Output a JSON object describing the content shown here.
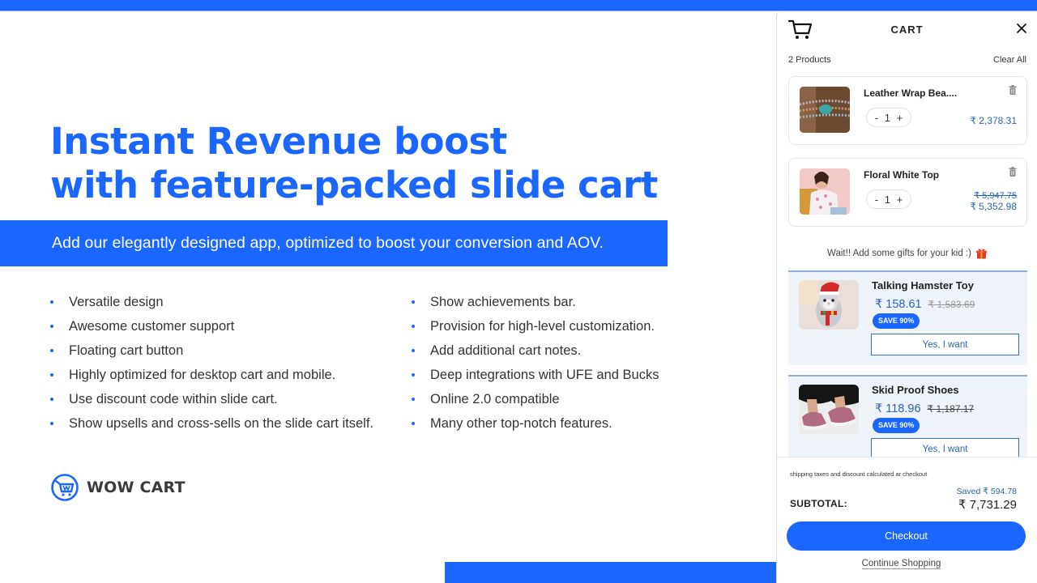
{
  "hero": {
    "headline_line1": "Instant Revenue boost",
    "headline_line2": "with feature-packed slide cart",
    "subtitle": "Add our elegantly designed app, optimized to boost your conversion and AOV."
  },
  "features": {
    "column1": [
      "Versatile design",
      "Awesome customer support",
      "Floating cart button",
      "Highly optimized for desktop cart and mobile.",
      "Use discount code within slide cart.",
      "Show upsells and cross-sells on the slide cart itself."
    ],
    "column2": [
      "Show achievements bar.",
      "Provision for high-level customization.",
      "Add additional cart notes.",
      "Deep integrations with UFE and Bucks",
      "Online 2.0 compatible",
      "Many other top-notch features."
    ]
  },
  "brand": {
    "name": "WOW CART",
    "icon": "cart-circle-logo",
    "color": "#1a66ff"
  },
  "cart": {
    "title": "CART",
    "product_count": "2 Products",
    "clear_all": "Clear All",
    "items": [
      {
        "name": "Leather Wrap Bea....",
        "quantity": "1",
        "price": "₹ 2,378.31",
        "old_price": null,
        "image": "bracelet-photo"
      },
      {
        "name": "Floral White Top",
        "quantity": "1",
        "price": "₹ 5,352.98",
        "old_price": "₹ 5,947.75",
        "image": "floral-top-photo"
      }
    ],
    "qty_minus": "-",
    "qty_plus": "+",
    "gift_message": "Wait!! Add some gifts for your kid :)",
    "upsells": [
      {
        "name": "Talking Hamster Toy",
        "price": "₹ 158.61",
        "old_price": "₹ 1,583.69",
        "badge": "SAVE 90%",
        "cta": "Yes, I want",
        "image": "hamster-toy-photo"
      },
      {
        "name": "Skid Proof Shoes",
        "price": "₹ 118.96",
        "old_price": "₹ 1,187.17",
        "badge": "SAVE 90%",
        "cta": "Yes, I want",
        "image": "shoes-photo"
      }
    ],
    "footer": {
      "note": "shipping taxes and discount calculated ar checkout",
      "saved": "Saved ₹ 594.78",
      "subtotal_label": "SUBTOTAL:",
      "subtotal_value": "₹ 7,731.29",
      "checkout": "Checkout",
      "continue_shopping": "Continue Shopping"
    }
  },
  "colors": {
    "accent": "#1a66ff",
    "price": "#2b63b5",
    "upsell_bg": "#eff4fb"
  }
}
